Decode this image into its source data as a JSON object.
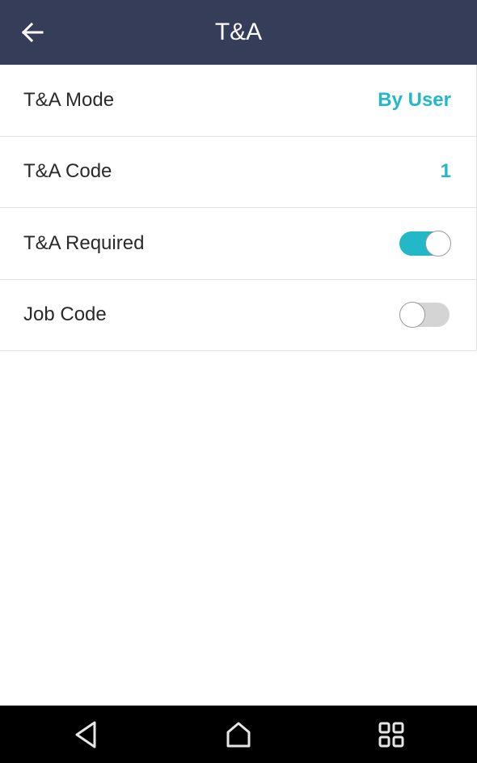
{
  "header": {
    "title": "T&A",
    "back_icon": "arrow-left-icon",
    "background": "#353d58"
  },
  "settings": [
    {
      "label": "T&A Mode",
      "type": "value",
      "value": "By User"
    },
    {
      "label": "T&A Code",
      "type": "value",
      "value": "1"
    },
    {
      "label": "T&A Required",
      "type": "toggle",
      "value": "on"
    },
    {
      "label": "Job Code",
      "type": "toggle",
      "value": "off"
    }
  ],
  "colors": {
    "accent": "#23b8c8",
    "toggle_off": "#d4d4d4"
  },
  "nav": {
    "back_icon": "triangle-back-icon",
    "home_icon": "home-icon",
    "recents_icon": "recent-apps-icon"
  }
}
